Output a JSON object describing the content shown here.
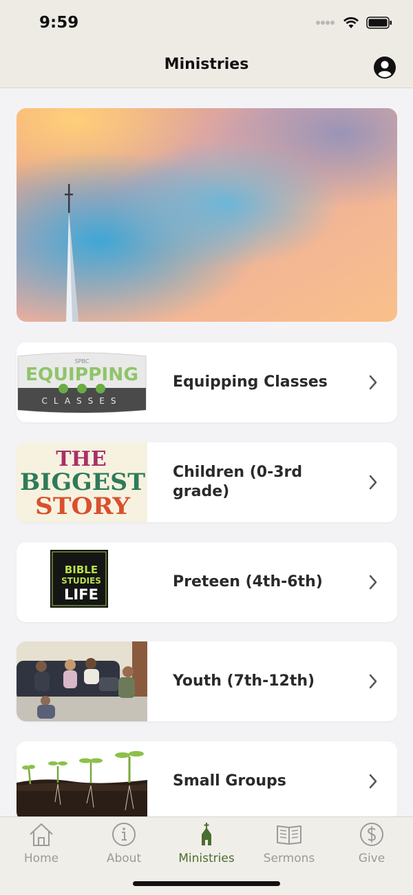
{
  "status": {
    "time": "9:59"
  },
  "nav": {
    "title": "Ministries"
  },
  "cards": [
    {
      "label": "Equipping Classes",
      "thumb": "equipping-classes-logo"
    },
    {
      "label": "Children (0-3rd grade)",
      "thumb": "the-biggest-story-art"
    },
    {
      "label": "Preteen (4th-6th)",
      "thumb": "bible-studies-for-life-cover"
    },
    {
      "label": "Youth (7th-12th)",
      "thumb": "youth-group-photo"
    },
    {
      "label": "Small Groups",
      "thumb": "sprouting-seedlings-photo"
    }
  ],
  "thumb_text": {
    "equipping_small": "SPBC",
    "equipping_big": "EQUIPPING",
    "equipping_sub": "CLASSES",
    "biggest_1": "THE",
    "biggest_2": "BIGGEST",
    "biggest_3": "STORY",
    "bible_1": "BIBLE",
    "bible_2": "STUDIES",
    "bible_3": "LIFE"
  },
  "tabs": [
    {
      "label": "Home",
      "icon": "home-icon"
    },
    {
      "label": "About",
      "icon": "info-icon"
    },
    {
      "label": "Ministries",
      "icon": "church-icon",
      "active": true
    },
    {
      "label": "Sermons",
      "icon": "book-icon"
    },
    {
      "label": "Give",
      "icon": "dollar-icon"
    }
  ],
  "colors": {
    "active_tab": "#4a6e2f",
    "inactive_tab": "#9a9a9a",
    "bar_bg": "#eeebe5"
  }
}
